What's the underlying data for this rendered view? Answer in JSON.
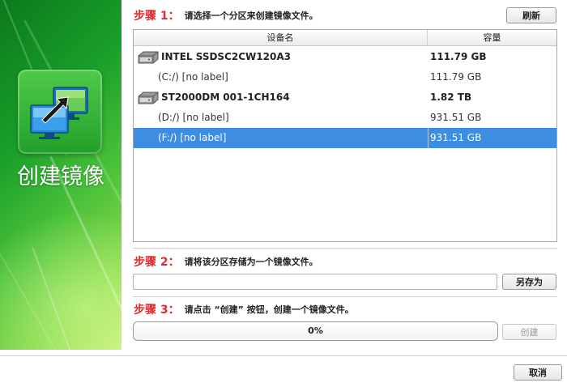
{
  "banner": {
    "title": "创建镜像"
  },
  "step1": {
    "label": "步骤 1：",
    "description": "请选择一个分区来创建镜像文件。",
    "refresh_label": "刷新"
  },
  "table": {
    "columns": {
      "device": "设备名",
      "capacity": "容量"
    },
    "rows": [
      {
        "kind": "disk",
        "name": "INTEL SSDSC2CW120A3",
        "capacity": "111.79 GB",
        "selected": false
      },
      {
        "kind": "partition",
        "name": "(C:/) [no label]",
        "capacity": "111.79 GB",
        "selected": false
      },
      {
        "kind": "disk",
        "name": "ST2000DM 001-1CH164",
        "capacity": "1.82 TB",
        "selected": false
      },
      {
        "kind": "partition",
        "name": "(D:/) [no label]",
        "capacity": "931.51 GB",
        "selected": false
      },
      {
        "kind": "partition",
        "name": "(F:/) [no label]",
        "capacity": "931.51 GB",
        "selected": true
      }
    ]
  },
  "step2": {
    "label": "步骤 2：",
    "description": "请将该分区存储为一个镜像文件。",
    "path_value": "",
    "save_as_label": "另存为"
  },
  "step3": {
    "label": "步骤 3：",
    "description": "请点击 “创建” 按钮，创建一个镜像文件。",
    "progress_text": "0%",
    "progress_value": 0,
    "create_label": "创建"
  },
  "footer": {
    "cancel_label": "取消"
  },
  "colors": {
    "selection": "#3d8ee2",
    "step_label": "#e22a2a",
    "banner_green": "#1aa02a"
  }
}
